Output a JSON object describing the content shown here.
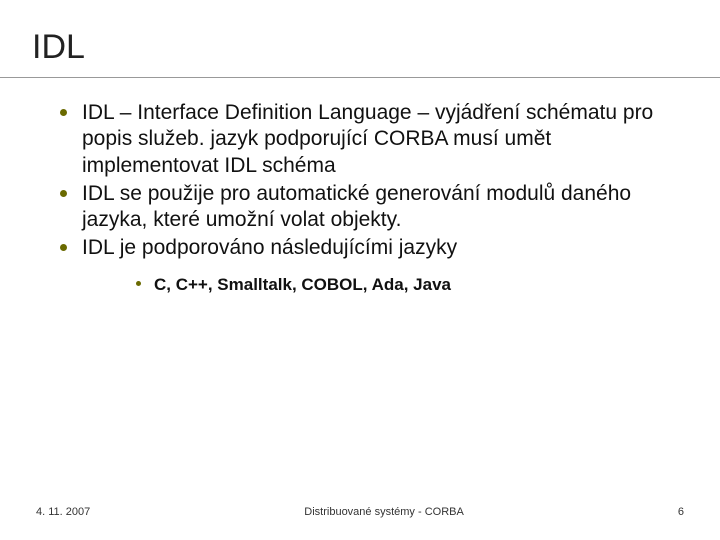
{
  "title": "IDL",
  "bullets": [
    "IDL – Interface Definition Language – vyjádření schématu pro popis služeb. jazyk podporující CORBA musí umět implementovat IDL schéma",
    "IDL se použije pro automatické generování modulů daného jazyka, které umožní volat objekty.",
    "IDL je podporováno následujícími jazyky"
  ],
  "subbullets": [
    "C, C++, Smalltalk, COBOL, Ada, Java"
  ],
  "footer": {
    "left": "4. 11. 2007",
    "center": "Distribuované systémy - CORBA",
    "right": "6"
  }
}
